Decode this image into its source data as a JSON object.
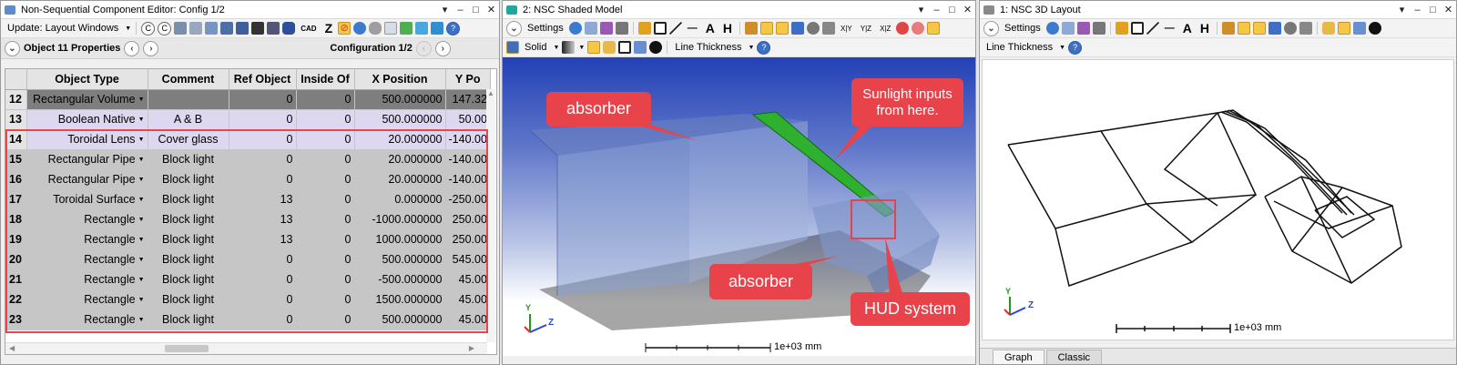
{
  "editor": {
    "title": "Non-Sequential Component Editor: Config 1/2",
    "update_label": "Update: Layout Windows",
    "cad_label": "CAD",
    "z_label": "Z",
    "object_label": "Object  11 Properties",
    "configuration_label": "Configuration 1/2",
    "columns": [
      "Object Type",
      "Comment",
      "Ref Object",
      "Inside Of",
      "X Position",
      "Y Po"
    ],
    "rows": [
      {
        "n": "12",
        "type": "Rectangular Volume",
        "comment": "",
        "ref": "0",
        "inside": "0",
        "x": "500.000000",
        "y": "147.32"
      },
      {
        "n": "13",
        "type": "Boolean Native",
        "comment": "A & B",
        "ref": "0",
        "inside": "0",
        "x": "500.000000",
        "y": "50.00"
      },
      {
        "n": "14",
        "type": "Toroidal Lens",
        "comment": "Cover glass",
        "ref": "0",
        "inside": "0",
        "x": "20.000000",
        "y": "-140.00"
      },
      {
        "n": "15",
        "type": "Rectangular Pipe",
        "comment": "Block light",
        "ref": "0",
        "inside": "0",
        "x": "20.000000",
        "y": "-140.00"
      },
      {
        "n": "16",
        "type": "Rectangular Pipe",
        "comment": "Block light",
        "ref": "0",
        "inside": "0",
        "x": "20.000000",
        "y": "-140.00"
      },
      {
        "n": "17",
        "type": "Toroidal Surface",
        "comment": "Block light",
        "ref": "13",
        "inside": "0",
        "x": "0.000000",
        "y": "-250.00"
      },
      {
        "n": "18",
        "type": "Rectangle",
        "comment": "Block light",
        "ref": "13",
        "inside": "0",
        "x": "-1000.000000",
        "y": "250.00"
      },
      {
        "n": "19",
        "type": "Rectangle",
        "comment": "Block light",
        "ref": "13",
        "inside": "0",
        "x": "1000.000000",
        "y": "250.00"
      },
      {
        "n": "20",
        "type": "Rectangle",
        "comment": "Block light",
        "ref": "0",
        "inside": "0",
        "x": "500.000000",
        "y": "545.00"
      },
      {
        "n": "21",
        "type": "Rectangle",
        "comment": "Block light",
        "ref": "0",
        "inside": "0",
        "x": "-500.000000",
        "y": "45.00"
      },
      {
        "n": "22",
        "type": "Rectangle",
        "comment": "Block light",
        "ref": "0",
        "inside": "0",
        "x": "1500.000000",
        "y": "45.00"
      },
      {
        "n": "23",
        "type": "Rectangle",
        "comment": "Block light",
        "ref": "0",
        "inside": "0",
        "x": "500.000000",
        "y": "45.00"
      }
    ]
  },
  "shaded": {
    "title": "2: NSC Shaded Model",
    "settings_label": "Settings",
    "solid_label": "Solid",
    "line_thickness_label": "Line Thickness",
    "axis_y": "Y",
    "axis_z": "Z",
    "scale_label": "1e+03 mm",
    "callouts": {
      "absorber_top": "absorber",
      "sunlight": "Sunlight inputs from here.",
      "absorber_bottom": "absorber",
      "hud": "HUD system"
    }
  },
  "layout3d": {
    "title": "1: NSC 3D Layout",
    "settings_label": "Settings",
    "line_thickness_label": "Line Thickness",
    "axis_y": "Y",
    "axis_z": "Z",
    "scale_label": "1e+03 mm",
    "tabs": [
      "Graph",
      "Classic"
    ]
  },
  "window_controls": {
    "dropdown": "▾",
    "minimize": "–",
    "maximize": "□",
    "close": "✕"
  },
  "colors": {
    "accent_red": "#e8434b",
    "highlight_orange": "#f6c744",
    "viewport_blue_top": "#1f3fb5",
    "viewport_white": "#ffffff"
  }
}
